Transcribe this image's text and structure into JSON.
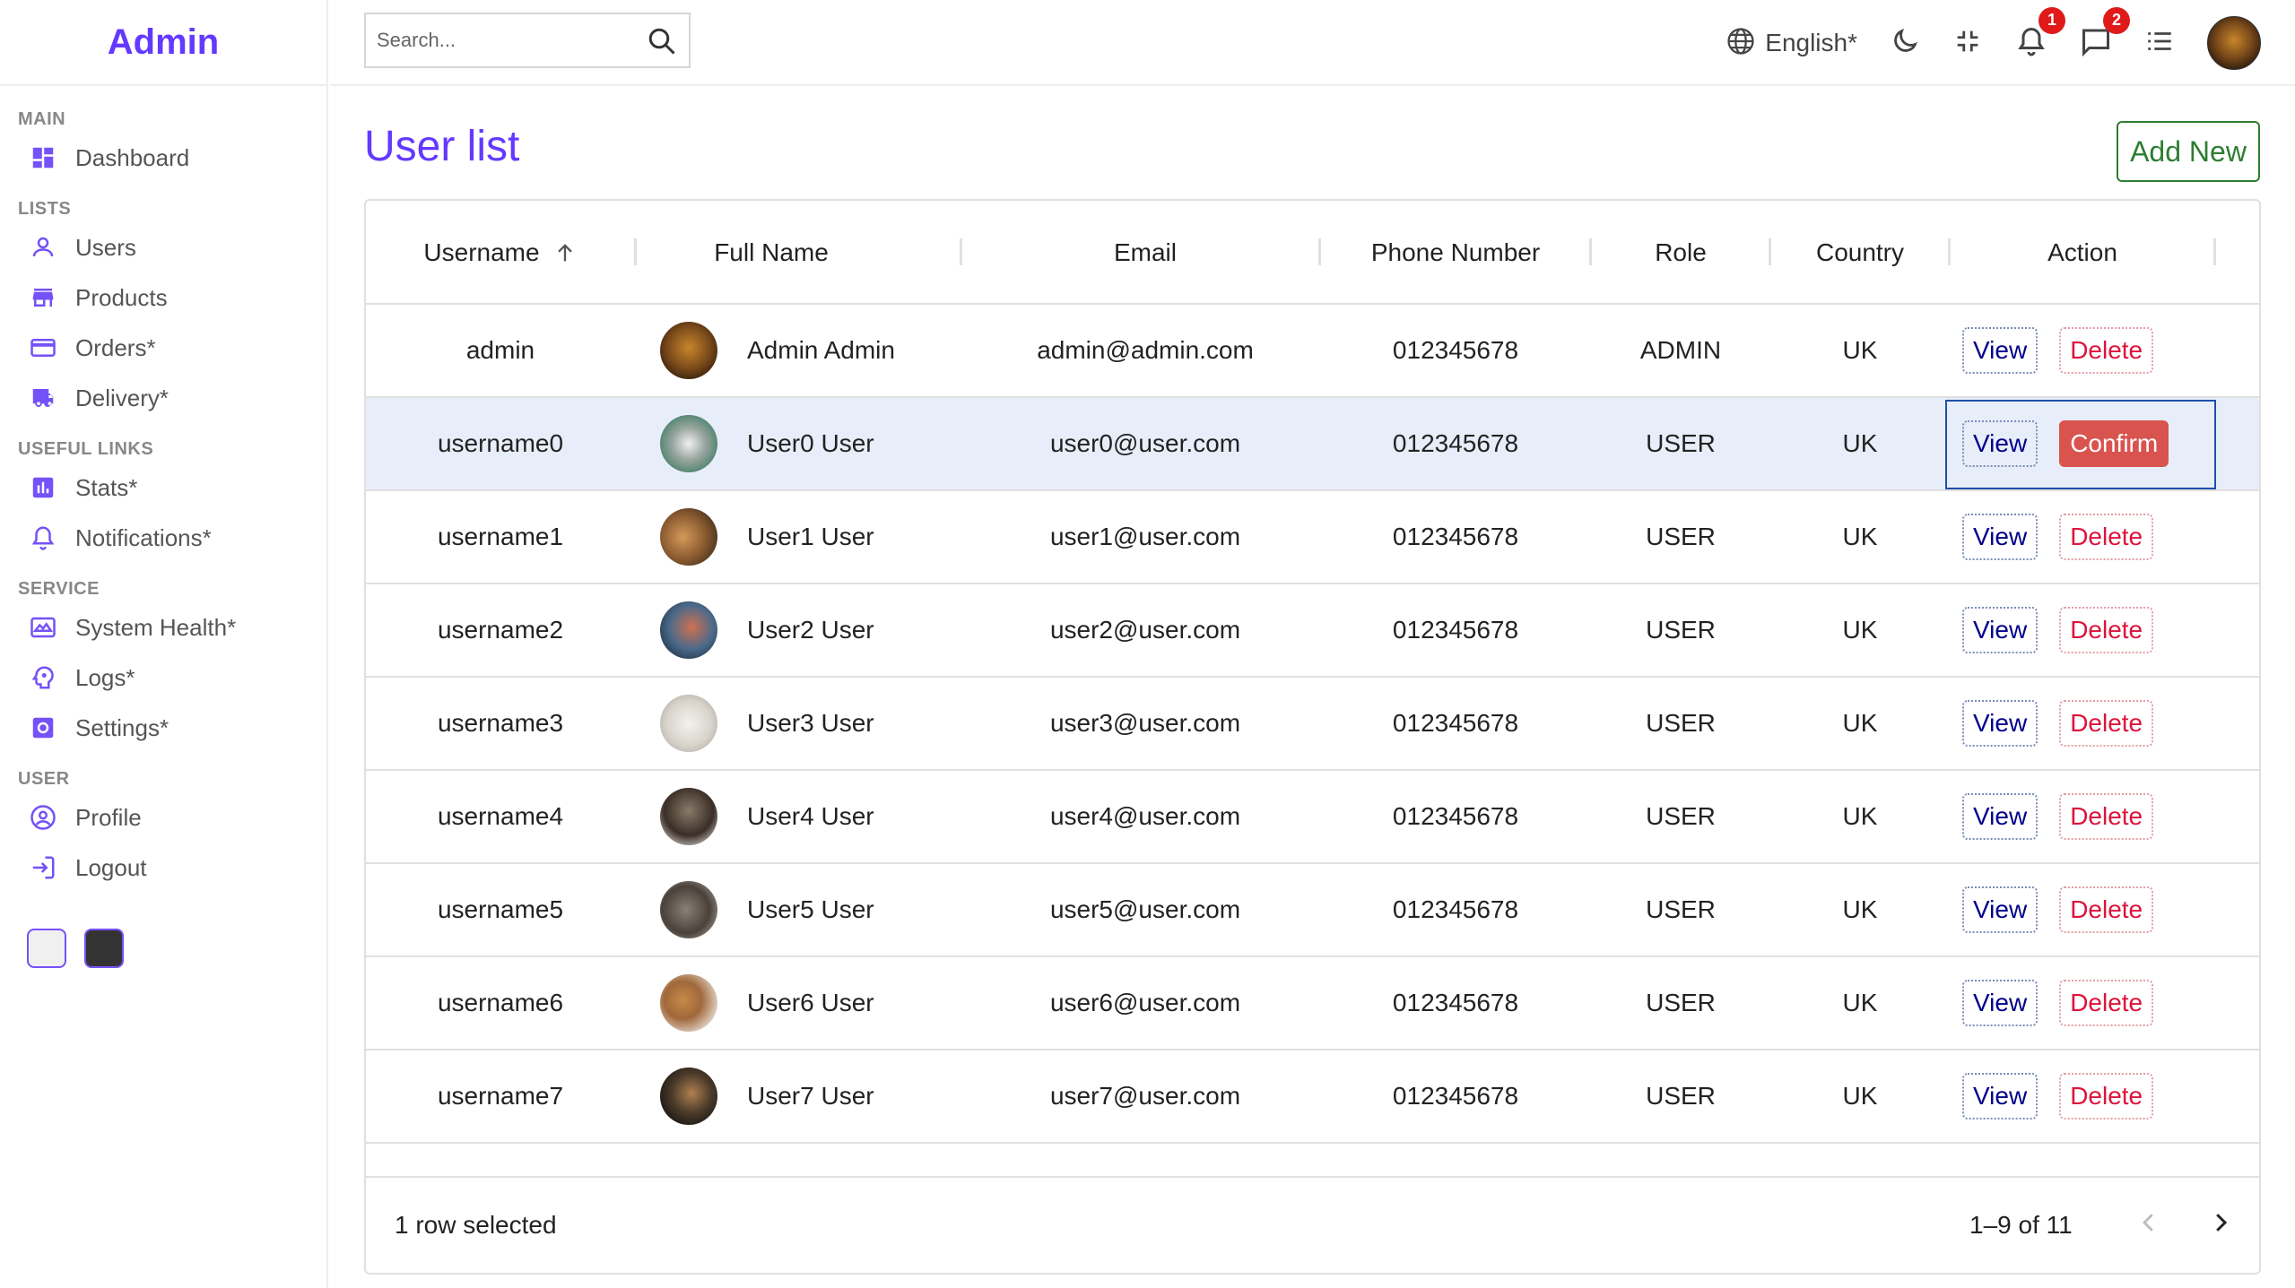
{
  "sidebar": {
    "logo": "Admin",
    "sections": [
      {
        "title": "MAIN",
        "items": [
          {
            "label": "Dashboard",
            "icon": "dashboard-icon"
          }
        ]
      },
      {
        "title": "LISTS",
        "items": [
          {
            "label": "Users",
            "icon": "person-icon"
          },
          {
            "label": "Products",
            "icon": "store-icon"
          },
          {
            "label": "Orders*",
            "icon": "credit-card-icon"
          },
          {
            "label": "Delivery*",
            "icon": "truck-icon"
          }
        ]
      },
      {
        "title": "USEFUL LINKS",
        "items": [
          {
            "label": "Stats*",
            "icon": "chart-icon"
          },
          {
            "label": "Notifications*",
            "icon": "bell-icon"
          }
        ]
      },
      {
        "title": "SERVICE",
        "items": [
          {
            "label": "System Health*",
            "icon": "health-icon"
          },
          {
            "label": "Logs*",
            "icon": "psychology-icon"
          },
          {
            "label": "Settings*",
            "icon": "settings-icon"
          }
        ]
      },
      {
        "title": "USER",
        "items": [
          {
            "label": "Profile",
            "icon": "profile-icon"
          },
          {
            "label": "Logout",
            "icon": "logout-icon"
          }
        ]
      }
    ],
    "theme_colors": [
      "#f0f0f0",
      "#333333"
    ]
  },
  "navbar": {
    "search_placeholder": "Search...",
    "language": "English*",
    "notifications_count": "1",
    "messages_count": "2"
  },
  "main": {
    "title": "User list",
    "add_new": "Add New"
  },
  "table": {
    "columns": [
      "Username",
      "Full Name",
      "Email",
      "Phone Number",
      "Role",
      "Country",
      "Action"
    ],
    "sort_column": "Username",
    "sort_direction": "asc",
    "rows": [
      {
        "username": "admin",
        "full_name": "Admin Admin",
        "email": "admin@admin.com",
        "phone": "012345678",
        "role": "ADMIN",
        "country": "UK",
        "view": "View",
        "action2": "Delete",
        "selected": false
      },
      {
        "username": "username0",
        "full_name": "User0 User",
        "email": "user0@user.com",
        "phone": "012345678",
        "role": "USER",
        "country": "UK",
        "view": "View",
        "action2": "Confirm",
        "selected": true
      },
      {
        "username": "username1",
        "full_name": "User1 User",
        "email": "user1@user.com",
        "phone": "012345678",
        "role": "USER",
        "country": "UK",
        "view": "View",
        "action2": "Delete",
        "selected": false
      },
      {
        "username": "username2",
        "full_name": "User2 User",
        "email": "user2@user.com",
        "phone": "012345678",
        "role": "USER",
        "country": "UK",
        "view": "View",
        "action2": "Delete",
        "selected": false
      },
      {
        "username": "username3",
        "full_name": "User3 User",
        "email": "user3@user.com",
        "phone": "012345678",
        "role": "USER",
        "country": "UK",
        "view": "View",
        "action2": "Delete",
        "selected": false
      },
      {
        "username": "username4",
        "full_name": "User4 User",
        "email": "user4@user.com",
        "phone": "012345678",
        "role": "USER",
        "country": "UK",
        "view": "View",
        "action2": "Delete",
        "selected": false
      },
      {
        "username": "username5",
        "full_name": "User5 User",
        "email": "user5@user.com",
        "phone": "012345678",
        "role": "USER",
        "country": "UK",
        "view": "View",
        "action2": "Delete",
        "selected": false
      },
      {
        "username": "username6",
        "full_name": "User6 User",
        "email": "user6@user.com",
        "phone": "012345678",
        "role": "USER",
        "country": "UK",
        "view": "View",
        "action2": "Delete",
        "selected": false
      },
      {
        "username": "username7",
        "full_name": "User7 User",
        "email": "user7@user.com",
        "phone": "012345678",
        "role": "USER",
        "country": "UK",
        "view": "View",
        "action2": "Delete",
        "selected": false
      }
    ],
    "footer": {
      "selected_text": "1 row selected",
      "pagination": "1–9 of 11"
    }
  },
  "colors": {
    "accent": "#6439ff",
    "sidebar_icon": "#7451f8",
    "add_new": "#2e7d32",
    "view": "#00008b",
    "delete": "#dc143c",
    "confirm_bg": "#d9534f",
    "selected_row": "#e8eef9"
  }
}
